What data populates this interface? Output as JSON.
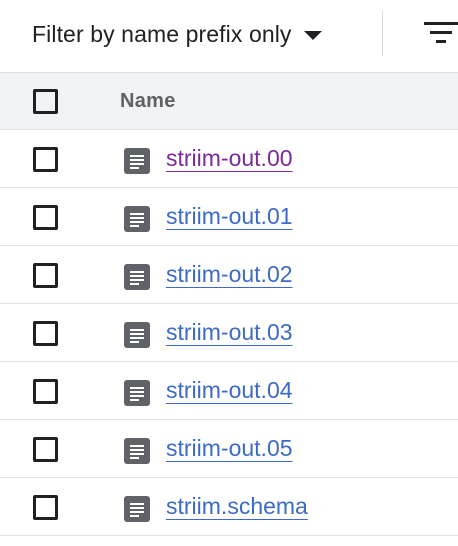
{
  "filter": {
    "label": "Filter by name prefix only",
    "dropdown_icon": "caret-down-icon",
    "filter_icon": "filter-list-icon"
  },
  "table": {
    "header": {
      "name": "Name"
    },
    "rows": [
      {
        "name": "striim-out.00",
        "icon": "file-icon",
        "visited": true
      },
      {
        "name": "striim-out.01",
        "icon": "file-icon",
        "visited": false
      },
      {
        "name": "striim-out.02",
        "icon": "file-icon",
        "visited": false
      },
      {
        "name": "striim-out.03",
        "icon": "file-icon",
        "visited": false
      },
      {
        "name": "striim-out.04",
        "icon": "file-icon",
        "visited": false
      },
      {
        "name": "striim-out.05",
        "icon": "file-icon",
        "visited": false
      },
      {
        "name": "striim.schema",
        "icon": "file-icon",
        "visited": false
      }
    ]
  },
  "colors": {
    "link": "#3c6bc6",
    "link_visited": "#7b2a99",
    "header_bg": "#f1f3f4",
    "icon": "#5f6368"
  }
}
